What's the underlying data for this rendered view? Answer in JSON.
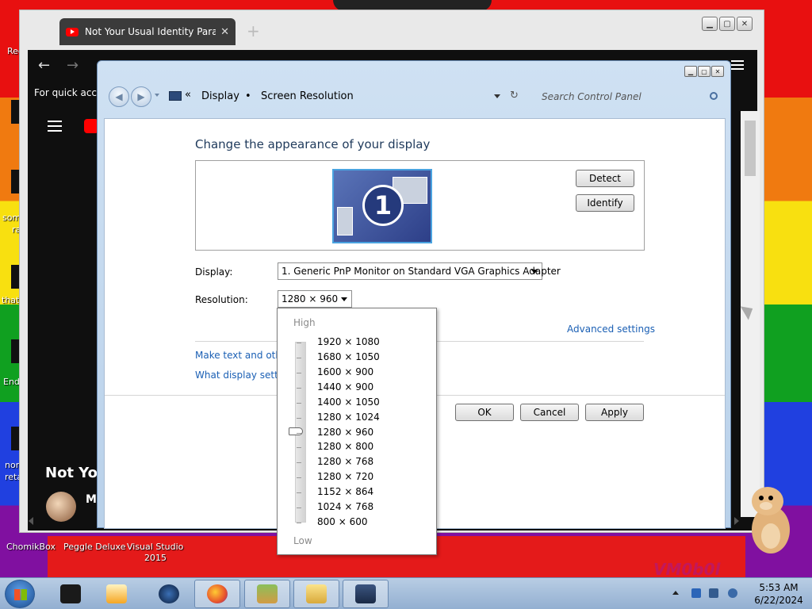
{
  "browser": {
    "tab_title": "Not Your Usual Identity Parade",
    "tab_close": "✕",
    "new_tab": "+",
    "back": "←",
    "forward": "→",
    "quick_access": "For quick acces",
    "video_title": "Not You",
    "channel_initial": "M"
  },
  "control_panel": {
    "breadcrumb_separator": "«",
    "breadcrumb": [
      "Display",
      "Screen Resolution"
    ],
    "search_placeholder": "Search Control Panel",
    "heading": "Change the appearance of your display",
    "monitor_number": "1",
    "detect_label": "Detect",
    "identify_label": "Identify",
    "display_label": "Display:",
    "display_value": "1. Generic PnP Monitor on Standard VGA Graphics Adapter",
    "resolution_label": "Resolution:",
    "resolution_value": "1280 × 960",
    "advanced_link": "Advanced settings",
    "text_link": "Make text and other",
    "settings_link": "What display setting",
    "ok_label": "OK",
    "cancel_label": "Cancel",
    "apply_label": "Apply"
  },
  "dropdown": {
    "high": "High",
    "low": "Low",
    "options": [
      "1920 × 1080",
      "1680 × 1050",
      "1600 × 900",
      "1440 × 900",
      "1400 × 1050",
      "1280 × 1024",
      "1280 × 960",
      "1280 × 800",
      "1280 × 768",
      "1280 × 720",
      "1152 × 864",
      "1024 × 768",
      "800 × 600"
    ],
    "selected_index": 6
  },
  "desktop": {
    "labels": [
      "Rec",
      "som",
      "ra",
      "that",
      "End",
      "non",
      "reta"
    ],
    "bottom_icons": [
      "ChomikBox",
      "Peggle Deluxe",
      "Visual Studio",
      "2015"
    ],
    "logo": "VM0b0l"
  },
  "taskbar": {
    "time": "5:53 AM",
    "date": "6/22/2024"
  },
  "colors": {
    "link": "#1a5fb4",
    "heading": "#1e395b",
    "taskbar": "#93afd1"
  }
}
